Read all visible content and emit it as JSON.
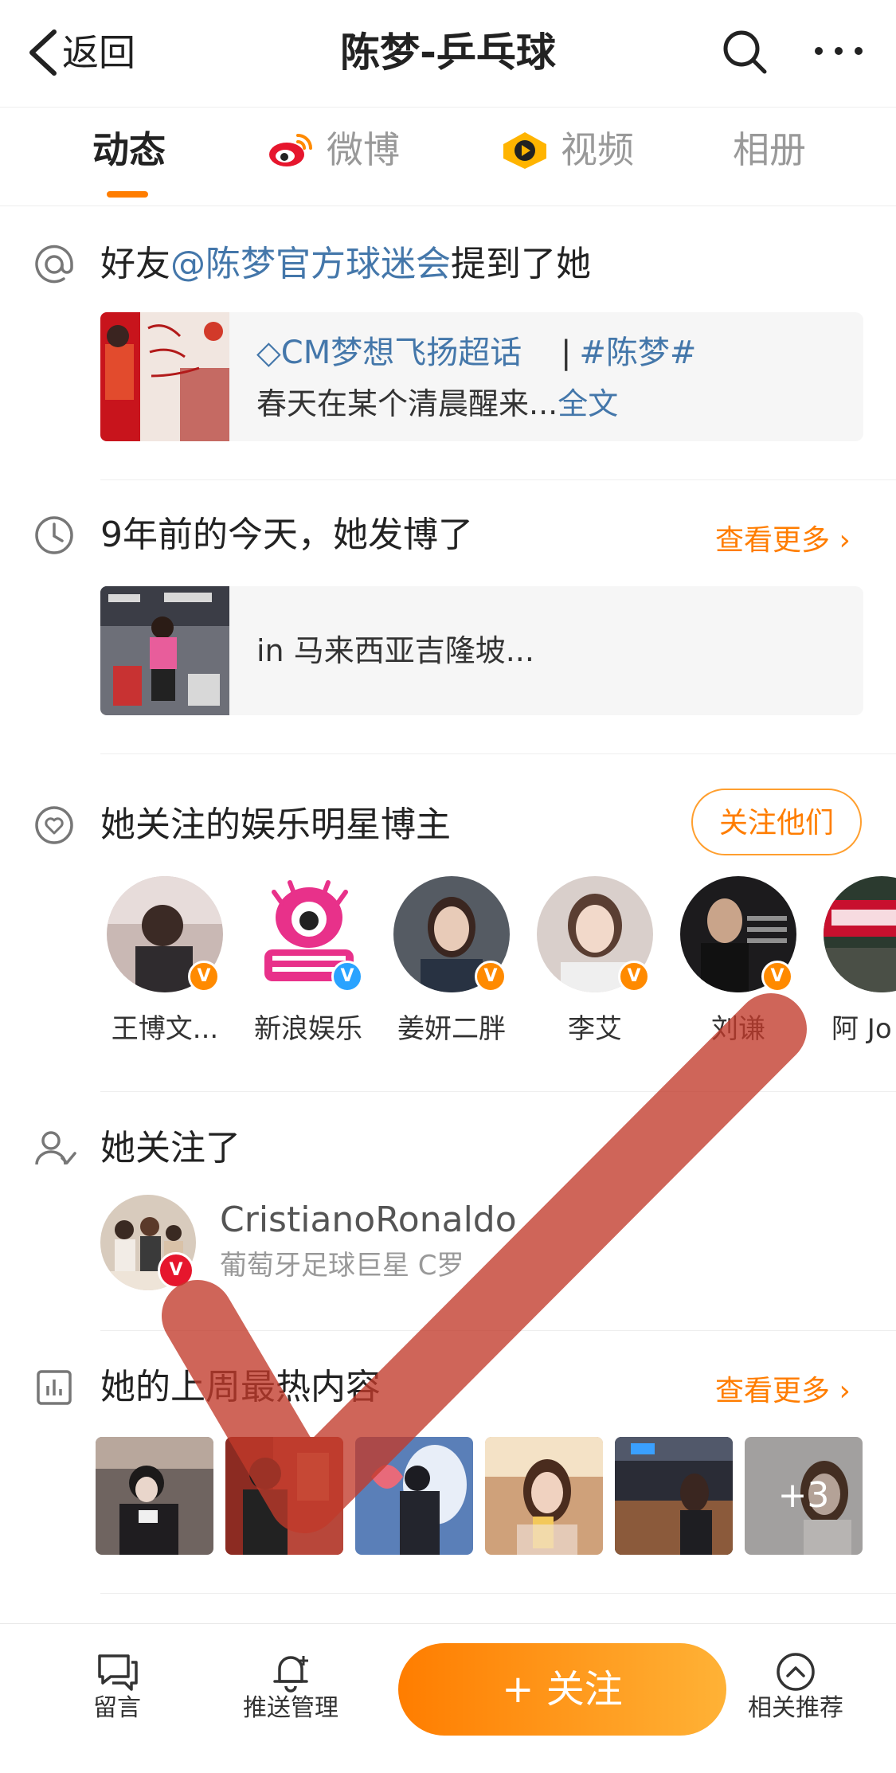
{
  "header": {
    "back_label": "返回",
    "title": "陈梦-乒乓球"
  },
  "tabs": [
    {
      "label": "动态",
      "active": true
    },
    {
      "label": "微博",
      "active": false
    },
    {
      "label": "视频",
      "active": false
    },
    {
      "label": "相册",
      "active": false
    }
  ],
  "mention": {
    "prefix": "好友",
    "user": "@陈梦官方球迷会",
    "suffix": "提到了她",
    "card_topic": "CM梦想飞扬超话",
    "card_separator": "|",
    "card_hashtag": "#陈梦#",
    "card_text": "春天在某个清晨醒来...",
    "card_fulltext": "全文"
  },
  "memory": {
    "title": "9年前的今天，她发博了",
    "more": "查看更多",
    "card_text": "in 马来西亚吉隆坡..."
  },
  "celebs": {
    "title": "她关注的娱乐明星博主",
    "follow_button": "关注他们",
    "items": [
      {
        "name": "王博文...",
        "badge": "orange"
      },
      {
        "name": "新浪娱乐",
        "badge": "blue"
      },
      {
        "name": "姜妍二胖",
        "badge": "orange"
      },
      {
        "name": "李艾",
        "badge": "orange"
      },
      {
        "name": "刘谦",
        "badge": "orange"
      },
      {
        "name": "阿 Jo",
        "badge": "none"
      }
    ]
  },
  "following": {
    "title": "她关注了",
    "name": "CristianoRonaldo",
    "desc": "葡萄牙足球巨星 C罗"
  },
  "hot": {
    "title": "她的上周最热内容",
    "more": "查看更多",
    "extra_count": "+3"
  },
  "bottom_bar": {
    "comment": "留言",
    "push": "推送管理",
    "follow": "+ 关注",
    "related": "相关推荐"
  },
  "colors": {
    "accent": "#ff7d00",
    "link": "#4477aa"
  }
}
